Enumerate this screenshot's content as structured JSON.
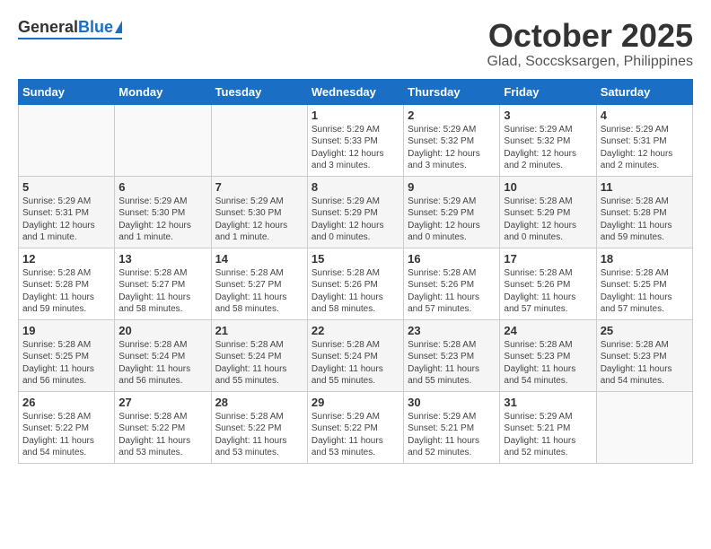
{
  "header": {
    "logo_general": "General",
    "logo_blue": "Blue",
    "month": "October 2025",
    "location": "Glad, Soccsksargen, Philippines"
  },
  "days_of_week": [
    "Sunday",
    "Monday",
    "Tuesday",
    "Wednesday",
    "Thursday",
    "Friday",
    "Saturday"
  ],
  "weeks": [
    [
      {
        "day": "",
        "info": ""
      },
      {
        "day": "",
        "info": ""
      },
      {
        "day": "",
        "info": ""
      },
      {
        "day": "1",
        "info": "Sunrise: 5:29 AM\nSunset: 5:33 PM\nDaylight: 12 hours\nand 3 minutes."
      },
      {
        "day": "2",
        "info": "Sunrise: 5:29 AM\nSunset: 5:32 PM\nDaylight: 12 hours\nand 3 minutes."
      },
      {
        "day": "3",
        "info": "Sunrise: 5:29 AM\nSunset: 5:32 PM\nDaylight: 12 hours\nand 2 minutes."
      },
      {
        "day": "4",
        "info": "Sunrise: 5:29 AM\nSunset: 5:31 PM\nDaylight: 12 hours\nand 2 minutes."
      }
    ],
    [
      {
        "day": "5",
        "info": "Sunrise: 5:29 AM\nSunset: 5:31 PM\nDaylight: 12 hours\nand 1 minute."
      },
      {
        "day": "6",
        "info": "Sunrise: 5:29 AM\nSunset: 5:30 PM\nDaylight: 12 hours\nand 1 minute."
      },
      {
        "day": "7",
        "info": "Sunrise: 5:29 AM\nSunset: 5:30 PM\nDaylight: 12 hours\nand 1 minute."
      },
      {
        "day": "8",
        "info": "Sunrise: 5:29 AM\nSunset: 5:29 PM\nDaylight: 12 hours\nand 0 minutes."
      },
      {
        "day": "9",
        "info": "Sunrise: 5:29 AM\nSunset: 5:29 PM\nDaylight: 12 hours\nand 0 minutes."
      },
      {
        "day": "10",
        "info": "Sunrise: 5:28 AM\nSunset: 5:29 PM\nDaylight: 12 hours\nand 0 minutes."
      },
      {
        "day": "11",
        "info": "Sunrise: 5:28 AM\nSunset: 5:28 PM\nDaylight: 11 hours\nand 59 minutes."
      }
    ],
    [
      {
        "day": "12",
        "info": "Sunrise: 5:28 AM\nSunset: 5:28 PM\nDaylight: 11 hours\nand 59 minutes."
      },
      {
        "day": "13",
        "info": "Sunrise: 5:28 AM\nSunset: 5:27 PM\nDaylight: 11 hours\nand 58 minutes."
      },
      {
        "day": "14",
        "info": "Sunrise: 5:28 AM\nSunset: 5:27 PM\nDaylight: 11 hours\nand 58 minutes."
      },
      {
        "day": "15",
        "info": "Sunrise: 5:28 AM\nSunset: 5:26 PM\nDaylight: 11 hours\nand 58 minutes."
      },
      {
        "day": "16",
        "info": "Sunrise: 5:28 AM\nSunset: 5:26 PM\nDaylight: 11 hours\nand 57 minutes."
      },
      {
        "day": "17",
        "info": "Sunrise: 5:28 AM\nSunset: 5:26 PM\nDaylight: 11 hours\nand 57 minutes."
      },
      {
        "day": "18",
        "info": "Sunrise: 5:28 AM\nSunset: 5:25 PM\nDaylight: 11 hours\nand 57 minutes."
      }
    ],
    [
      {
        "day": "19",
        "info": "Sunrise: 5:28 AM\nSunset: 5:25 PM\nDaylight: 11 hours\nand 56 minutes."
      },
      {
        "day": "20",
        "info": "Sunrise: 5:28 AM\nSunset: 5:24 PM\nDaylight: 11 hours\nand 56 minutes."
      },
      {
        "day": "21",
        "info": "Sunrise: 5:28 AM\nSunset: 5:24 PM\nDaylight: 11 hours\nand 55 minutes."
      },
      {
        "day": "22",
        "info": "Sunrise: 5:28 AM\nSunset: 5:24 PM\nDaylight: 11 hours\nand 55 minutes."
      },
      {
        "day": "23",
        "info": "Sunrise: 5:28 AM\nSunset: 5:23 PM\nDaylight: 11 hours\nand 55 minutes."
      },
      {
        "day": "24",
        "info": "Sunrise: 5:28 AM\nSunset: 5:23 PM\nDaylight: 11 hours\nand 54 minutes."
      },
      {
        "day": "25",
        "info": "Sunrise: 5:28 AM\nSunset: 5:23 PM\nDaylight: 11 hours\nand 54 minutes."
      }
    ],
    [
      {
        "day": "26",
        "info": "Sunrise: 5:28 AM\nSunset: 5:22 PM\nDaylight: 11 hours\nand 54 minutes."
      },
      {
        "day": "27",
        "info": "Sunrise: 5:28 AM\nSunset: 5:22 PM\nDaylight: 11 hours\nand 53 minutes."
      },
      {
        "day": "28",
        "info": "Sunrise: 5:28 AM\nSunset: 5:22 PM\nDaylight: 11 hours\nand 53 minutes."
      },
      {
        "day": "29",
        "info": "Sunrise: 5:29 AM\nSunset: 5:22 PM\nDaylight: 11 hours\nand 53 minutes."
      },
      {
        "day": "30",
        "info": "Sunrise: 5:29 AM\nSunset: 5:21 PM\nDaylight: 11 hours\nand 52 minutes."
      },
      {
        "day": "31",
        "info": "Sunrise: 5:29 AM\nSunset: 5:21 PM\nDaylight: 11 hours\nand 52 minutes."
      },
      {
        "day": "",
        "info": ""
      }
    ]
  ]
}
